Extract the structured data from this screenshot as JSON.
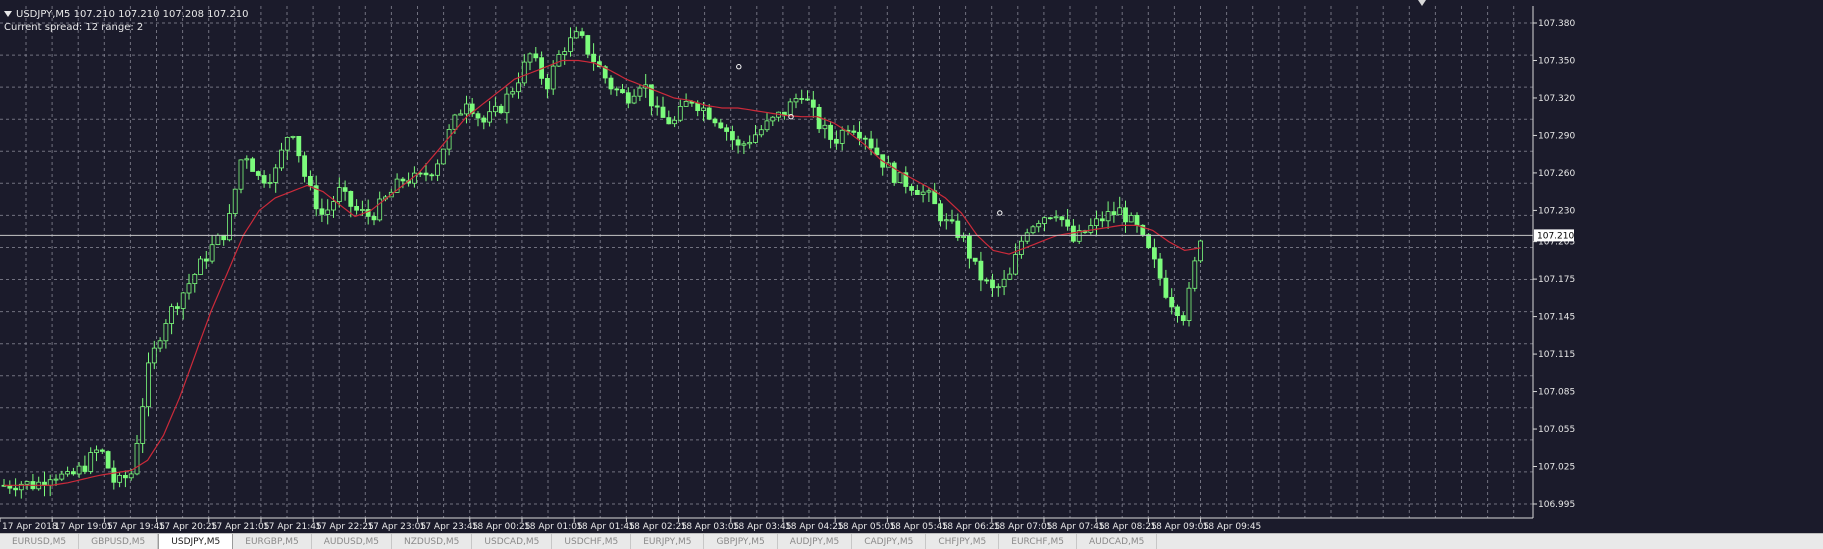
{
  "header": {
    "info_line": "USDJPY,M5  107.210 107.210 107.208 107.210",
    "spread_line": "Current spread: 12 range: 2"
  },
  "current_price_label": "107.210",
  "colors": {
    "background": "#1b1b2b",
    "grid": "#8e8e9c",
    "candle": "#7CFC7C",
    "moving_average": "#cc2a3a",
    "price_line": "#c8c8c8",
    "axis_text": "#e8e8e8"
  },
  "chart_data": {
    "type": "candlestick",
    "symbol": "USDJPY",
    "timeframe": "M5",
    "ylim": [
      106.985,
      107.395
    ],
    "yticks": [
      "107.380",
      "107.350",
      "107.320",
      "107.290",
      "107.260",
      "107.230",
      "107.205",
      "107.175",
      "107.145",
      "107.115",
      "107.085",
      "107.055",
      "107.025",
      "106.995"
    ],
    "xticks": [
      "17 Apr 2018",
      "17 Apr 19:05",
      "17 Apr 19:45",
      "17 Apr 20:25",
      "17 Apr 21:05",
      "17 Apr 21:45",
      "17 Apr 22:25",
      "17 Apr 23:05",
      "17 Apr 23:45",
      "18 Apr 00:25",
      "18 Apr 01:05",
      "18 Apr 01:45",
      "18 Apr 02:25",
      "18 Apr 03:05",
      "18 Apr 03:45",
      "18 Apr 04:25",
      "18 Apr 05:05",
      "18 Apr 05:45",
      "18 Apr 06:25",
      "18 Apr 07:05",
      "18 Apr 07:45",
      "18 Apr 08:25",
      "18 Apr 09:05",
      "18 Apr 09:45"
    ],
    "current_price": 107.21,
    "close_path": [
      107.01,
      107.012,
      107.01,
      107.02,
      107.015,
      107.025,
      107.04,
      107.01,
      107.02,
      107.1,
      107.14,
      107.16,
      107.18,
      107.2,
      107.215,
      107.28,
      107.255,
      107.26,
      107.3,
      107.25,
      107.225,
      107.245,
      107.23,
      107.225,
      107.24,
      107.255,
      107.255,
      107.265,
      107.295,
      107.32,
      107.3,
      107.31,
      107.33,
      107.355,
      107.33,
      107.36,
      107.37,
      107.35,
      107.33,
      107.32,
      107.335,
      107.305,
      107.3,
      107.32,
      107.31,
      107.3,
      107.28,
      107.29,
      107.3,
      107.31,
      107.325,
      107.3,
      107.285,
      107.3,
      107.29,
      107.27,
      107.255,
      107.25,
      107.24,
      107.22,
      107.21,
      107.18,
      107.165,
      107.175,
      107.215,
      107.225,
      107.23,
      107.205,
      107.215,
      107.225,
      107.23,
      107.215,
      107.19,
      107.16,
      107.145,
      107.21
    ],
    "ma_path": [
      107.01,
      107.01,
      107.01,
      107.01,
      107.012,
      107.015,
      107.018,
      107.02,
      107.022,
      107.03,
      107.05,
      107.08,
      107.115,
      107.15,
      107.18,
      107.21,
      107.23,
      107.24,
      107.245,
      107.25,
      107.245,
      107.235,
      107.225,
      107.23,
      107.24,
      107.25,
      107.26,
      107.275,
      107.29,
      107.305,
      107.315,
      107.325,
      107.335,
      107.34,
      107.345,
      107.35,
      107.35,
      107.348,
      107.342,
      107.335,
      107.33,
      107.325,
      107.32,
      107.318,
      107.314,
      107.312,
      107.312,
      107.31,
      107.308,
      107.306,
      107.305,
      107.305,
      107.3,
      107.292,
      107.282,
      107.27,
      107.262,
      107.255,
      107.248,
      107.24,
      107.228,
      107.21,
      107.198,
      107.195,
      107.2,
      107.205,
      107.21,
      107.212,
      107.214,
      107.216,
      107.218,
      107.218,
      107.214,
      107.205,
      107.198,
      107.2
    ],
    "path_x_range": [
      "17 Apr 2018",
      "18 Apr 09:45"
    ],
    "markers": [
      {
        "time": "18 Apr 03:45",
        "price": 107.345
      },
      {
        "time": "18 Apr 04:25",
        "price": 107.305
      },
      {
        "time": "18 Apr 07:05",
        "price": 107.228
      }
    ]
  },
  "tabs": [
    {
      "label": "EURUSD,M5",
      "active": false
    },
    {
      "label": "GBPUSD,M5",
      "active": false
    },
    {
      "label": "USDJPY,M5",
      "active": true
    },
    {
      "label": "EURGBP,M5",
      "active": false
    },
    {
      "label": "AUDUSD,M5",
      "active": false
    },
    {
      "label": "NZDUSD,M5",
      "active": false
    },
    {
      "label": "USDCAD,M5",
      "active": false
    },
    {
      "label": "USDCHF,M5",
      "active": false
    },
    {
      "label": "EURJPY,M5",
      "active": false
    },
    {
      "label": "GBPJPY,M5",
      "active": false
    },
    {
      "label": "AUDJPY,M5",
      "active": false
    },
    {
      "label": "CADJPY,M5",
      "active": false
    },
    {
      "label": "CHFJPY,M5",
      "active": false
    },
    {
      "label": "EURCHF,M5",
      "active": false
    },
    {
      "label": "AUDCAD,M5",
      "active": false
    }
  ]
}
